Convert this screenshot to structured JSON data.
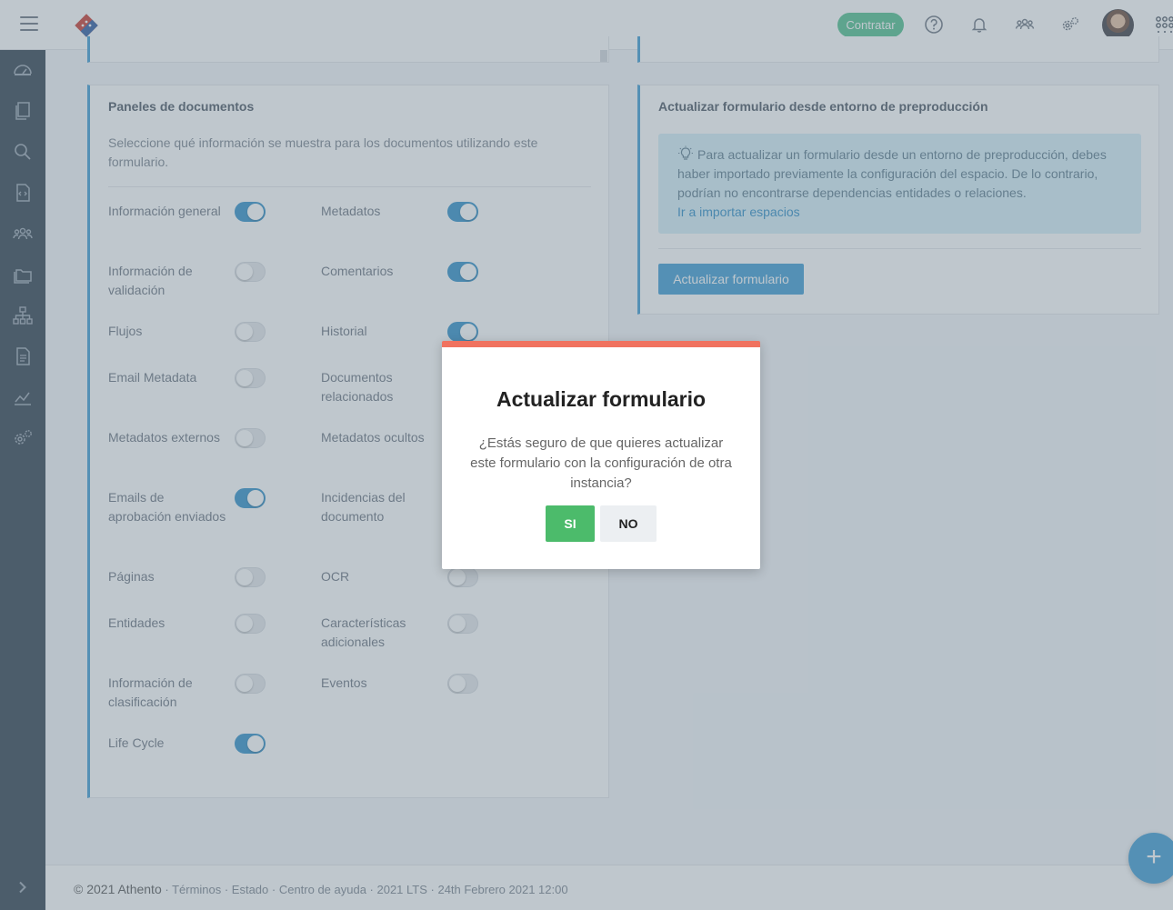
{
  "header": {
    "contract_button": "Contratar",
    "icons": [
      "hamburger-icon",
      "athento-logo-icon",
      "help-icon",
      "bell-icon",
      "users-icon",
      "settings-icon",
      "avatar",
      "apps-grid-icon"
    ]
  },
  "sidebar": {
    "icons": [
      "dashboard-icon",
      "documents-icon",
      "search-icon",
      "code-file-icon",
      "team-icon",
      "folders-icon",
      "hierarchy-icon",
      "form-icon",
      "chart-icon",
      "admin-settings-icon"
    ]
  },
  "panels": {
    "title": "Paneles de documentos",
    "description": "Seleccione qué información se muestra para los documentos utilizando este formulario.",
    "toggles": [
      {
        "label": "Información general",
        "on": true
      },
      {
        "label": "Metadatos",
        "on": true
      },
      {
        "label": "Información de validación",
        "on": false
      },
      {
        "label": "Comentarios",
        "on": true
      },
      {
        "label": "Flujos",
        "on": false
      },
      {
        "label": "Historial",
        "on": true
      },
      {
        "label": "Email Metadata",
        "on": false
      },
      {
        "label": "Documentos relacionados",
        "on": false
      },
      {
        "label": "Metadatos externos",
        "on": false
      },
      {
        "label": "Metadatos ocultos",
        "on": false
      },
      {
        "label": "Emails de aprobación enviados",
        "on": true
      },
      {
        "label": "Incidencias del documento",
        "on": false
      },
      {
        "label": "Páginas",
        "on": false
      },
      {
        "label": "OCR",
        "on": false
      },
      {
        "label": "Entidades",
        "on": false
      },
      {
        "label": "Características adicionales",
        "on": false
      },
      {
        "label": "Información de clasificación",
        "on": false
      },
      {
        "label": "Eventos",
        "on": false
      },
      {
        "label": "Life Cycle",
        "on": true
      }
    ]
  },
  "preproduction": {
    "title": "Actualizar formulario desde entorno de preproducción",
    "info_text": "Para actualizar un formulario desde un entorno de preproducción, debes haber importado previamente la configuración del espacio. De lo contrario, podrían no encontrarse dependencias entidades o relaciones.",
    "info_link": "Ir a importar espacios",
    "update_button": "Actualizar formulario"
  },
  "modal": {
    "title": "Actualizar formulario",
    "text": "¿Estás seguro de que quieres actualizar este formulario con la configuración de otra instancia?",
    "yes": "SI",
    "no": "NO",
    "accent": "#f0725f"
  },
  "footer": {
    "brand": "© 2021 Athento",
    "links": "· Términos · Estado · Centro de ayuda · 2021 LTS · 24th Febrero 2021 12:00"
  },
  "fab_label": "+",
  "colors": {
    "primary": "#3c9bd4",
    "success": "#4cbb6b",
    "sidebar": "#2f3e4e"
  }
}
